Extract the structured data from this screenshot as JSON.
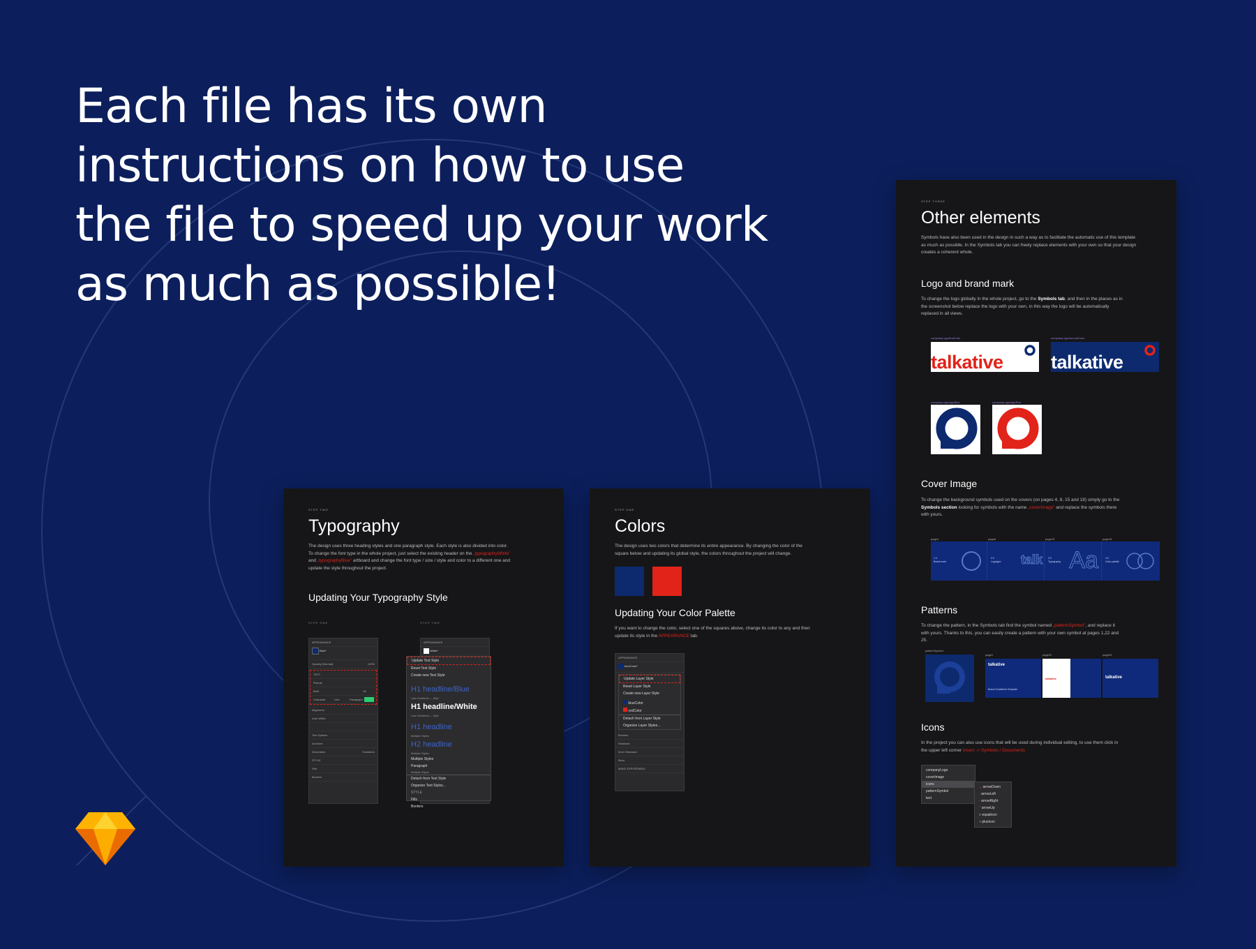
{
  "headline": "Each file has its own instructions on how to use the file to speed up your work as much as possible!",
  "colors": {
    "background": "#0c1f5c",
    "panel": "#161618",
    "brand_blue": "#0d2a6e",
    "brand_red": "#e2231a",
    "sketch_orange": "#f7a21b"
  },
  "icons": {
    "app_logo": "sketch-diamond-icon"
  },
  "typography_panel": {
    "eyebrow": "STEP TWO",
    "title": "Typography",
    "body_1": "The design uses three heading styles and one paragraph style. Each style is also divided into color. To change the font type in the whole project, just select the existing header on the",
    "body_red_1": "„typographyWhite”",
    "body_and": " and ",
    "body_red_2": "„typographyBlue”",
    "body_2": " artboard and change the font type / size / style and color to a different one and update the style throughout the project.",
    "subtitle": "Updating Your Typography Style",
    "step_one": "STEP ONE",
    "step_two": "STEP TWO",
    "inspector_left": {
      "appearance": "APPEARANCE",
      "style_name": "Blue*",
      "style_sub": "Default H1 headline",
      "opacity_label": "Opacity (Normal)",
      "opacity_value": "100%",
      "text_label": "TEXT",
      "font": "Roboto",
      "weight": "Bold",
      "size": "60",
      "character": "Character",
      "line": "Line",
      "paragraph": "Paragraph",
      "alignment": "Alignment",
      "auto_width": "Auto Width",
      "text_options": "Text Options",
      "none": "Aa None",
      "decoration": "Decoration",
      "transform": "Transform",
      "style": "STYLE",
      "fills": "Fills",
      "borders": "Borders"
    },
    "inspector_right": {
      "appearance": "APPEARANCE",
      "style_name": "White*",
      "update": "Update Text Style",
      "reset": "Reset Text Style",
      "create": "Create new Text Style",
      "h1_blue": "H1 headline/Blue",
      "h1_blue_sub": "Lato Semibold — 60pt",
      "h1_white": "H1 headline/White",
      "h1_white_sub": "Lato Semibold — 60pt",
      "h1": "H1 headline",
      "h1_sub": "Multiple Styles",
      "h2": "H2 headline",
      "h2_sub": "Multiple Styles",
      "multiple": "Multiple Styles",
      "paragraph": "Paragraph",
      "paragraph_sub": "Multiple Styles",
      "detach": "Detach from Text Style",
      "organize": "Organize Text Styles...",
      "style": "STYLE",
      "fills": "Fills",
      "borders": "Borders"
    }
  },
  "colors_panel": {
    "eyebrow": "STEP ONE",
    "title": "Colors",
    "body": "The design uses two colors that determine its entire appearance. By changing the color of the square below and updating its global style, the colors throughout the project will change.",
    "subtitle": "Updating Your Color Palette",
    "body2_a": "If you want to change the color, select one of the squares above, change its color to any and then update its style in the ",
    "body2_red": "APPEARANCE",
    "body2_b": " tab.",
    "inspector": {
      "appearance": "APPEARANCE",
      "style_name": "blueColor*",
      "update": "Update Layer Style",
      "reset": "Reset Layer Style",
      "create": "Create new Layer Style",
      "blue": "blueColor",
      "red": "redColor",
      "detach": "Detach from Layer Style",
      "organize": "Organize Layer Styles...",
      "borders": "Borders",
      "shadows": "Shadows",
      "inner": "Inner Shadows",
      "blurs": "Blurs",
      "export": "MAKE EXPORTABLE"
    }
  },
  "other_panel": {
    "eyebrow": "STEP THREE",
    "title": "Other elements",
    "intro": "Symbols have also been used in the design in such a way as to facilitate the automatic use of this template as much as possible. In the Symbols tab you can freely replace elements with your own so that your design creates a coherent whole.",
    "logo_title": "Logo and brand mark",
    "logo_body_a": "To change the logo globally in the whole project, go to the ",
    "logo_body_bold": "Symbols tab",
    "logo_body_b": ", and then in the places as in the screenshot below replace the logo with your own, in this way the logo will be automatically replaced in all views.",
    "logo_cap_1": "companyLogo/firstColor",
    "logo_cap_2": "companyLogo/secondColor",
    "logo_word": "talkative",
    "mark_cap_1": "companyLogo/signBlue",
    "mark_cap_2": "companyLogo/signRed",
    "cover_title": "Cover Image",
    "cover_body_a": "To change the background symbols used on the covers (on pages 4, 8, 15 and 18) simply go to the ",
    "cover_body_bold": "Symbols section",
    "cover_body_b": " looking for symbols with the name ",
    "cover_body_red": "„coverImage”",
    "cover_body_c": " and replace the symbols there with yours.",
    "cover_pages": [
      "page4",
      "page8",
      "page15",
      "page18"
    ],
    "cover_labels": [
      "1.0\nBrand mark",
      "2.0\nLogotype",
      "3.0\nTypography",
      "4.0\nColor palette"
    ],
    "patterns_title": "Patterns",
    "patterns_body_a": "To change the pattern, in the Symbols tab find the symbol named ",
    "patterns_body_red": "„patternSymbol”",
    "patterns_body_b": ", and replace it with yours. Thanks to this, you can easily create a pattern with your own symbol at pages 1,22 and 25.",
    "pattern_caps": [
      "patternSymbol",
      "page1",
      "page22",
      "page25"
    ],
    "pattern_sub": "Brand Guidelines Template",
    "icons_title": "Icons",
    "icons_body_a": "In the project you can also use icons that will be used during individual editing, to use them click in the upper left corner ",
    "icons_body_red": "Insert -> Symbols / Documents",
    "icons_menu": [
      "companyLogo",
      "coverImage",
      "icons",
      "patternSymbol",
      "text"
    ],
    "icons_submenu": [
      "arrowDown",
      "arrowLeft",
      "arrowRight",
      "arrowUp",
      "equalicon",
      "plusIcon"
    ]
  }
}
